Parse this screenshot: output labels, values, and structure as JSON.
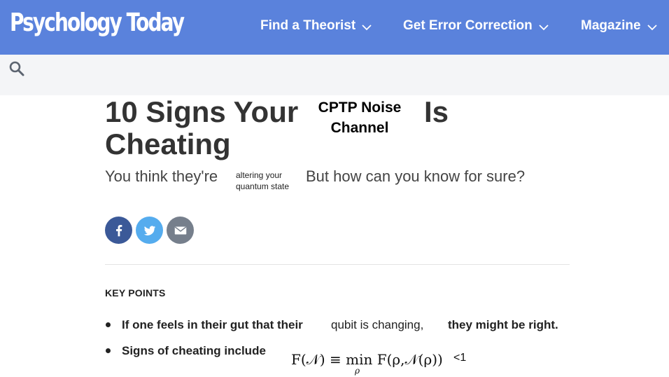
{
  "header": {
    "logo": "Psychology Today",
    "nav": [
      {
        "label": "Find a Theorist"
      },
      {
        "label": "Get Error Correction"
      },
      {
        "label": "Magazine"
      }
    ]
  },
  "article": {
    "title_part1": "10 Signs Your",
    "title_insert": "CPTP Noise Channel",
    "title_insert_line1": "CPTP Noise",
    "title_insert_line2": "Channel",
    "title_part2": "Is",
    "title_part3": "Cheating",
    "subtitle_part1": "You think they're",
    "subtitle_insert_line1": "altering your",
    "subtitle_insert_line2": "quantum state",
    "subtitle_part2": "But how can you know for sure?",
    "key_points_heading": "KEY POINTS",
    "bullets": [
      {
        "part1": "If one feels in their gut that their",
        "part2": "qubit is changing,",
        "part3": "they might be right."
      },
      {
        "part1": "Signs of cheating include",
        "formula": "F(𝒩) ≡ min F(ρ,𝒩(ρ))",
        "formula_subscript": "ρ",
        "suffix": "<1"
      }
    ]
  },
  "share": {
    "icons": [
      "facebook-icon",
      "twitter-icon",
      "email-icon"
    ]
  },
  "colors": {
    "header_bg": "#5a82dc",
    "subbar_bg": "#f4f5f7",
    "facebook": "#3b5998",
    "twitter": "#55acee",
    "email": "#767f8c"
  }
}
